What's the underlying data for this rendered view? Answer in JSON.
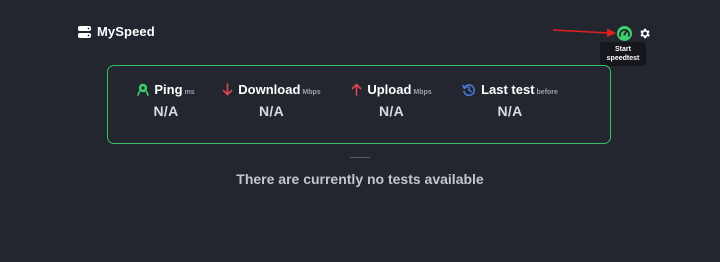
{
  "app": {
    "title": "MySpeed"
  },
  "header": {
    "tooltip": {
      "line1": "Start",
      "line2": "speedtest"
    },
    "speedtest_icon": "speedometer-icon",
    "settings_icon": "gear-icon"
  },
  "stats": [
    {
      "label": "Ping",
      "unit": "ms",
      "value": "N/A",
      "icon": "ping-icon",
      "color": "#3ccf6b"
    },
    {
      "label": "Download",
      "unit": "Mbps",
      "value": "N/A",
      "icon": "arrow-down-icon",
      "color": "#e0474c"
    },
    {
      "label": "Upload",
      "unit": "Mbps",
      "value": "N/A",
      "icon": "arrow-up-icon",
      "color": "#e0474c"
    },
    {
      "label": "Last test",
      "unit": "before",
      "value": "N/A",
      "icon": "history-icon",
      "color": "#4a78d6"
    }
  ],
  "empty_message": "There are currently no tests available",
  "colors": {
    "background": "#23262f",
    "accent_green": "#34c062",
    "annotation_red": "#e02020"
  }
}
